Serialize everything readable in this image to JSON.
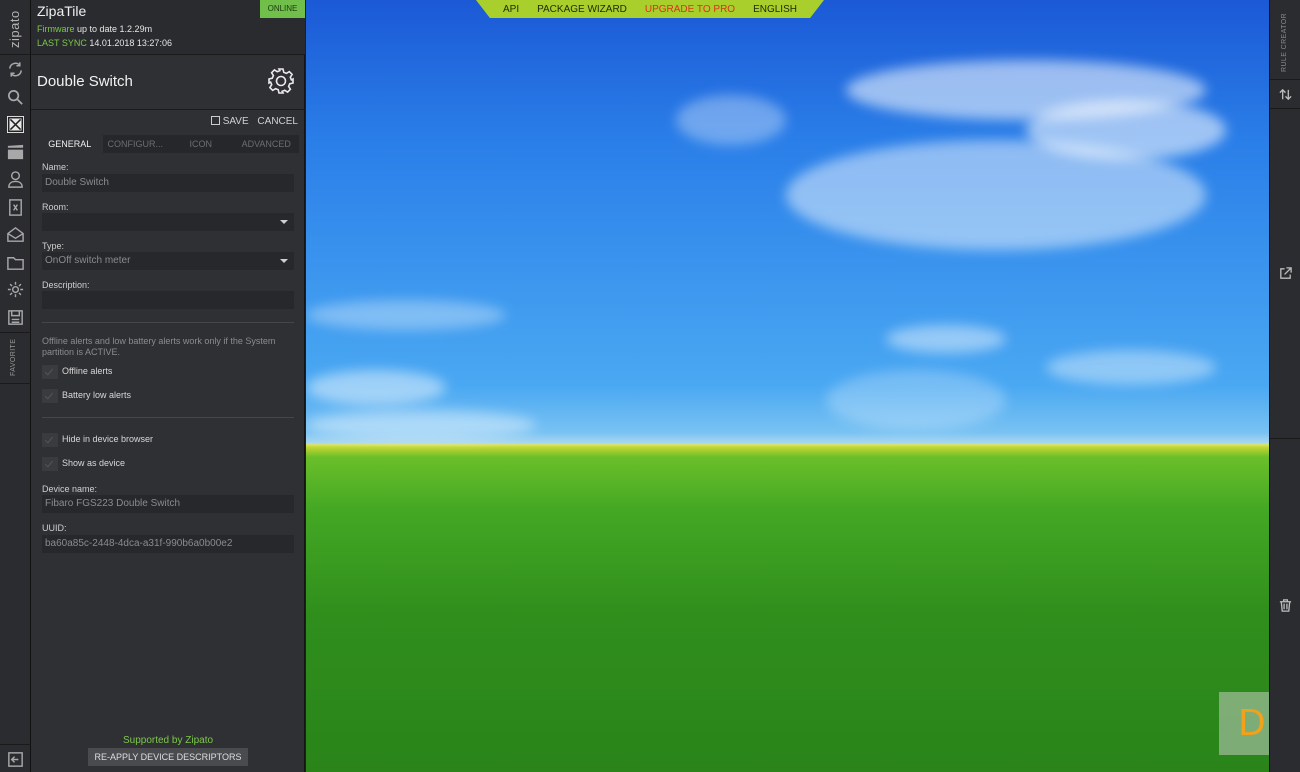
{
  "app": {
    "brand": "zipato",
    "title": "ZipaTile",
    "status": "ONLINE",
    "firmware_label": "Firmware",
    "firmware_value": "up to date 1.2.29m",
    "sync_label": "LAST SYNC",
    "sync_value": "14.01.2018 13:27:06",
    "favorite_label": "FAVORITE"
  },
  "device": {
    "title": "Double Switch",
    "save_label": "SAVE",
    "cancel_label": "CANCEL"
  },
  "tabs": [
    "GENERAL",
    "CONFIGUR...",
    "ICON",
    "ADVANCED"
  ],
  "form": {
    "name_label": "Name:",
    "name_value": "Double Switch",
    "room_label": "Room:",
    "room_value": "",
    "type_label": "Type:",
    "type_value": "OnOff switch meter",
    "description_label": "Description:",
    "description_value": "",
    "note": "Offline alerts and low battery alerts work only if the System partition is ACTIVE.",
    "offline_alerts": "Offline alerts",
    "battery_alerts": "Battery low alerts",
    "hide_browser": "Hide in device browser",
    "show_device": "Show as device",
    "device_name_label": "Device name:",
    "device_name_value": "Fibaro FGS223 Double Switch",
    "uuid_label": "UUID:",
    "uuid_value": "ba60a85c-2448-4dca-a31f-990b6a0b00e2"
  },
  "footer": {
    "supported": "Supported by Zipato",
    "reapply": "RE-APPLY DEVICE DESCRIPTORS"
  },
  "topnav": {
    "api": "API",
    "wizard": "PACKAGE WIZARD",
    "upgrade": "UPGRADE TO PRO",
    "language": "ENGLISH"
  },
  "right_rail": {
    "rule_creator": "RULE CREATOR"
  },
  "watermark": "D",
  "colors": {
    "accent_green": "#7cc84a",
    "nav_bar": "#a9cf2c",
    "upgrade": "#d8331c",
    "logo_orange": "#f0a21a"
  }
}
